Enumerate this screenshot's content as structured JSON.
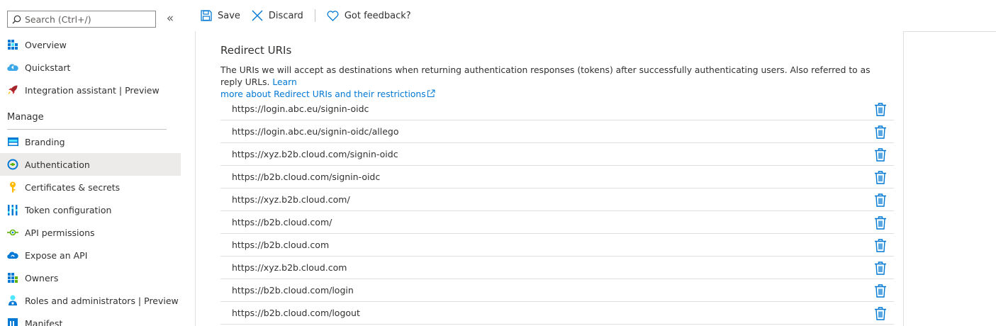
{
  "sidebar": {
    "search_placeholder": "Search (Ctrl+/)",
    "collapse_glyph": "«",
    "top_items": [
      {
        "label": "Overview",
        "icon": "overview-grid-icon"
      },
      {
        "label": "Quickstart",
        "icon": "cloud-quickstart-icon"
      },
      {
        "label": "Integration assistant | Preview",
        "icon": "rocket-icon"
      }
    ],
    "manage_heading": "Manage",
    "manage_items": [
      {
        "label": "Branding",
        "icon": "branding-icon"
      },
      {
        "label": "Authentication",
        "icon": "authentication-icon",
        "active": true
      },
      {
        "label": "Certificates & secrets",
        "icon": "key-icon"
      },
      {
        "label": "Token configuration",
        "icon": "token-bars-icon"
      },
      {
        "label": "API permissions",
        "icon": "api-permissions-icon"
      },
      {
        "label": "Expose an API",
        "icon": "cloud-api-icon"
      },
      {
        "label": "Owners",
        "icon": "owners-grid-icon"
      },
      {
        "label": "Roles and administrators | Preview",
        "icon": "roles-admin-icon"
      },
      {
        "label": "Manifest",
        "icon": "manifest-icon"
      }
    ]
  },
  "toolbar": {
    "save_label": "Save",
    "discard_label": "Discard",
    "feedback_label": "Got feedback?"
  },
  "redirect": {
    "title": "Redirect URIs",
    "description": "The URIs we will accept as destinations when returning authentication responses (tokens) after successfully authenticating users. Also referred to as reply URLs.",
    "learn_more_line1": "Learn",
    "learn_more_line2": "more about Redirect URIs and their restrictions",
    "uris": [
      "https://login.abc.eu/signin-oidc",
      "https://login.abc.eu/signin-oidc/allego",
      "https://xyz.b2b.cloud.com/signin-oidc",
      "https://b2b.cloud.com/signin-oidc",
      "https://xyz.b2b.cloud.com/",
      "https://b2b.cloud.com/",
      "https://b2b.cloud.com",
      "https://xyz.b2b.cloud.com",
      "https://b2b.cloud.com/login",
      "https://b2b.cloud.com/logout"
    ]
  },
  "colors": {
    "accent": "#0078d4",
    "active_nav_bg": "#edebe9",
    "text": "#323130"
  }
}
